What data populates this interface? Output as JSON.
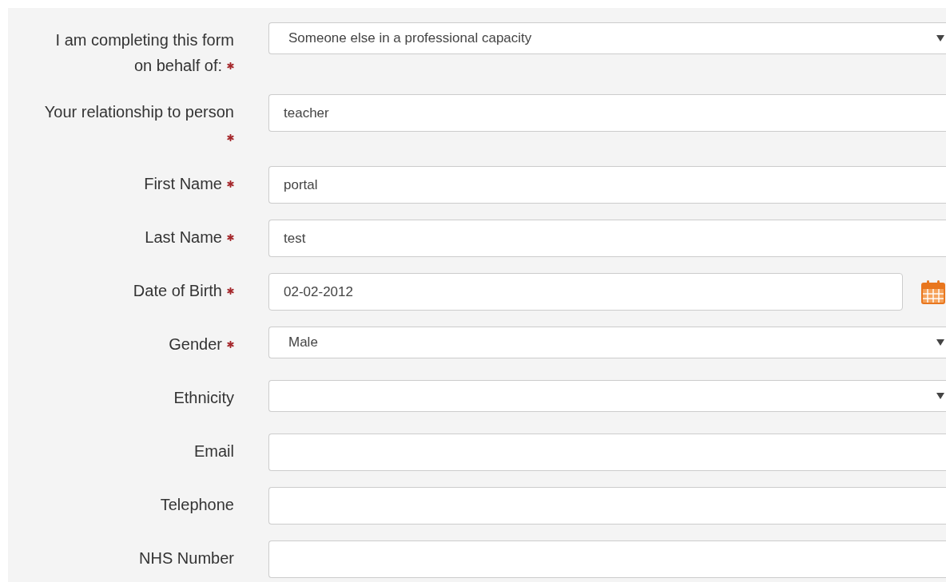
{
  "fields": [
    {
      "label": "I am completing this form on behalf of:",
      "required": true,
      "kind": "select",
      "value": "Someone else in a professional capacity"
    },
    {
      "label": "Your relationship to person",
      "required": true,
      "kind": "text",
      "value": "teacher"
    },
    {
      "label": "First Name",
      "required": true,
      "kind": "text",
      "value": "portal"
    },
    {
      "label": "Last Name",
      "required": true,
      "kind": "text",
      "value": "test"
    },
    {
      "label": "Date of Birth",
      "required": true,
      "kind": "date",
      "value": "02-02-2012"
    },
    {
      "label": "Gender",
      "required": true,
      "kind": "select",
      "value": "Male"
    },
    {
      "label": "Ethnicity",
      "required": false,
      "kind": "select"
    },
    {
      "label": "Email",
      "required": false,
      "kind": "text"
    },
    {
      "label": "Telephone",
      "required": false,
      "kind": "text"
    },
    {
      "label": "NHS Number",
      "required": false,
      "kind": "text"
    }
  ]
}
